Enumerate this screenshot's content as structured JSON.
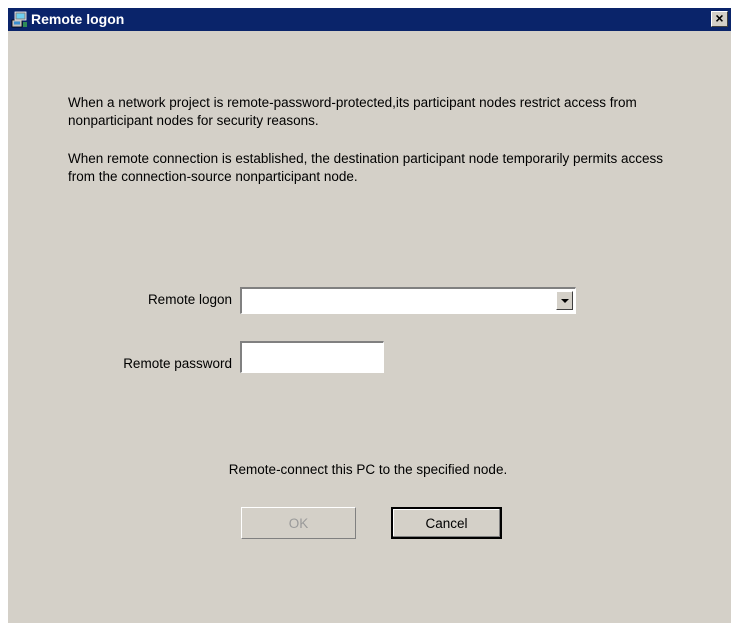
{
  "window": {
    "title": "Remote logon",
    "close_glyph": "×",
    "icon": "network-computer-icon"
  },
  "description": {
    "paragraph1": "When a network project is remote-password-protected,its participant nodes restrict access from nonparticipant nodes for security reasons.",
    "paragraph2": "When remote connection is established, the destination participant node temporarily permits access from the connection-source nonparticipant node."
  },
  "form": {
    "remote_logon_label": "Remote logon",
    "remote_logon_value": "",
    "remote_password_label": "Remote password",
    "remote_password_value": ""
  },
  "info_text": "Remote-connect this PC to the specified node.",
  "buttons": {
    "ok_label": "OK",
    "ok_enabled": false,
    "cancel_label": "Cancel"
  },
  "colors": {
    "titlebar": "#0a246a",
    "dialog_bg": "#d4d0c8",
    "disabled_text": "#9a9a9a"
  }
}
